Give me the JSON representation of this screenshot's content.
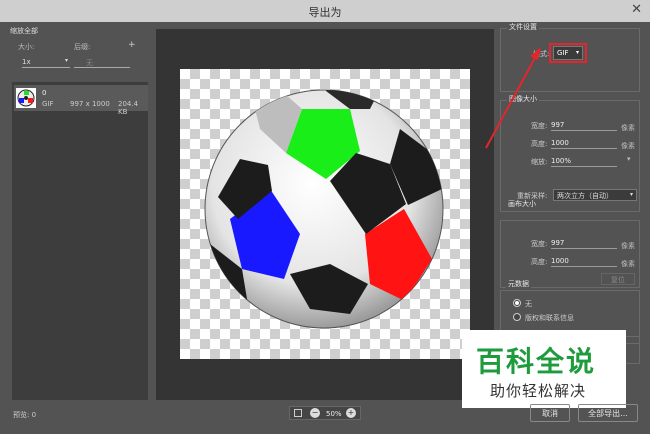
{
  "window": {
    "title": "导出为",
    "close_glyph": "✕"
  },
  "left_panel": {
    "header": "缩放全部",
    "size_label": "大小:",
    "suffix_label": "后缀:",
    "add_glyph": "+",
    "scale_value": "1x",
    "suffix_placeholder": "无",
    "assets": [
      {
        "name": "0",
        "format": "GIF",
        "dimensions": "997 x 1000",
        "size": "204.4 KB"
      }
    ]
  },
  "file_settings": {
    "title": "文件设置",
    "format_label": "格式:",
    "format_value": "GIF",
    "highlight_color": "#e3262c"
  },
  "image_size": {
    "title": "图像大小",
    "width_label": "宽度:",
    "width_value": "997",
    "height_label": "高度:",
    "height_value": "1000",
    "unit": "像素",
    "scale_label": "缩放:",
    "scale_value": "100%",
    "resample_label": "重新采样:",
    "resample_value": "两次立方（自动）"
  },
  "canvas_size": {
    "title": "画布大小",
    "width_label": "宽度:",
    "width_value": "997",
    "height_label": "高度:",
    "height_value": "1000",
    "unit": "像素",
    "reset_label": "复位"
  },
  "metadata": {
    "title": "元数据",
    "option_none": "无",
    "option_copyright": "版权和联系信息"
  },
  "footer": {
    "preview_label": "预览: 0",
    "zoom_value": "50%",
    "cancel_label": "取消",
    "export_all_label": "全部导出..."
  },
  "watermark": {
    "title": "百科全说",
    "subtitle": "助你轻松解决"
  }
}
